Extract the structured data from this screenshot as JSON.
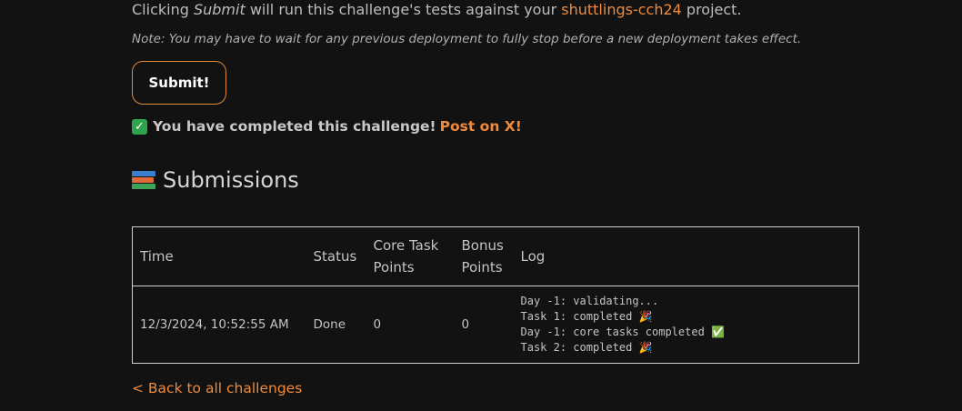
{
  "intro": {
    "prefix": "Clicking",
    "submit_word": "Submit",
    "middle": "will run this challenge's tests against your",
    "project_link": "shuttlings-cch24",
    "suffix": "project."
  },
  "note": "Note: You may have to wait for any previous deployment to fully stop before a new deployment takes effect.",
  "submit_button": "Submit!",
  "completed": {
    "icon": "check-mark-icon",
    "text": "You have completed this challenge!",
    "post_link": "Post on X!"
  },
  "submissions": {
    "icon": "books-icon",
    "heading": "Submissions",
    "columns": [
      "Time",
      "Status",
      "Core Task Points",
      "Bonus Points",
      "Log"
    ],
    "rows": [
      {
        "time": "12/3/2024, 10:52:55 AM",
        "status": "Done",
        "core_points": "0",
        "bonus_points": "0",
        "log": [
          "Day -1: validating...",
          "Task 1: completed 🎉",
          "Day -1: core tasks completed ✅",
          "Task 2: completed 🎉"
        ]
      }
    ]
  },
  "back_link": "< Back to all challenges",
  "colors": {
    "background": "#121212",
    "accent": "#f08a3c",
    "success": "#2fa44f",
    "text": "#bdbdbd"
  }
}
